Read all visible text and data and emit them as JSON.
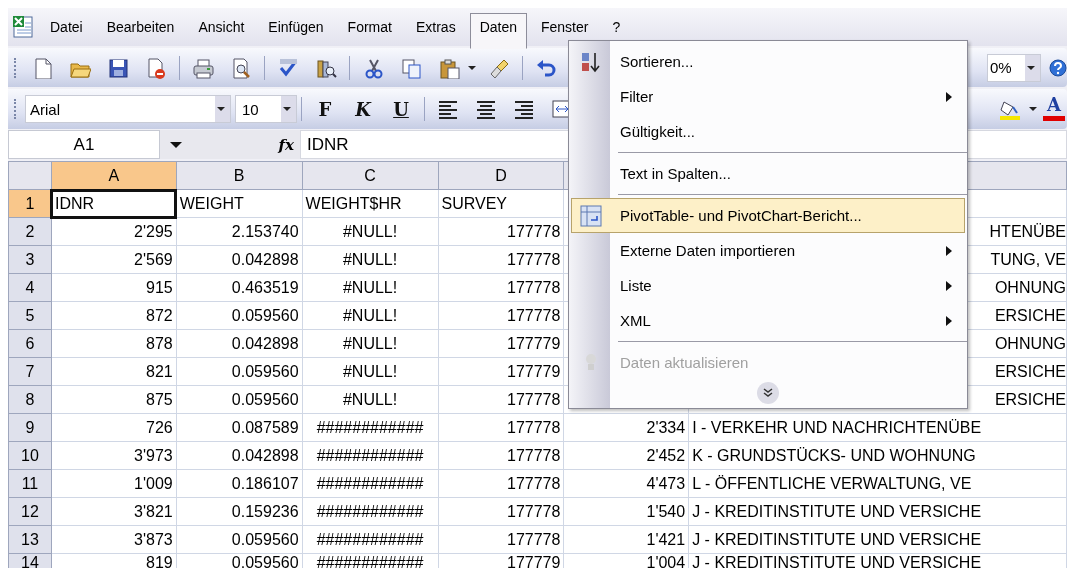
{
  "menu_bar": [
    {
      "label": "Datei",
      "selected": false
    },
    {
      "label": "Bearbeiten",
      "selected": false
    },
    {
      "label": "Ansicht",
      "selected": false
    },
    {
      "label": "Einfügen",
      "selected": false
    },
    {
      "label": "Format",
      "selected": false
    },
    {
      "label": "Extras",
      "selected": false
    },
    {
      "label": "Daten",
      "selected": true
    },
    {
      "label": "Fenster",
      "selected": false
    },
    {
      "label": "?",
      "selected": false
    }
  ],
  "standard_toolbar": {
    "zoom": "0%"
  },
  "formatting_toolbar": {
    "font": "Arial",
    "size": "10",
    "bold": "F",
    "italic": "K",
    "underline": "U",
    "font_color": "A"
  },
  "formula_bar": {
    "name_box": "A1",
    "function_label": "fx",
    "content": "IDNR"
  },
  "sheet": {
    "columns": [
      {
        "label": "A",
        "selected": true
      },
      {
        "label": "B",
        "selected": false
      },
      {
        "label": "C",
        "selected": false
      },
      {
        "label": "D",
        "selected": false
      }
    ],
    "rows": [
      {
        "number": "1",
        "selected": true,
        "cells": [
          "IDNR",
          "WEIGHT",
          "WEIGHT$HR",
          "SURVEY"
        ]
      },
      {
        "number": "2",
        "selected": false,
        "cells": [
          "2'295",
          "2.153740",
          "#NULL!",
          "177778"
        ],
        "column_f": {
          "text": "HTENÜBE",
          "covered": true
        }
      },
      {
        "number": "3",
        "selected": false,
        "cells": [
          "2'569",
          "0.042898",
          "#NULL!",
          "177778"
        ],
        "column_f": {
          "text": "TUNG, VE",
          "covered": true
        }
      },
      {
        "number": "4",
        "selected": false,
        "cells": [
          "915",
          "0.463519",
          "#NULL!",
          "177778"
        ],
        "column_f": {
          "text": "OHNUNG",
          "covered": true
        }
      },
      {
        "number": "5",
        "selected": false,
        "cells": [
          "872",
          "0.059560",
          "#NULL!",
          "177778"
        ],
        "column_f": {
          "text": "ERSICHE",
          "covered": true
        }
      },
      {
        "number": "6",
        "selected": false,
        "cells": [
          "878",
          "0.042898",
          "#NULL!",
          "177779"
        ],
        "column_f": {
          "text": "OHNUNG",
          "covered": true
        }
      },
      {
        "number": "7",
        "selected": false,
        "cells": [
          "821",
          "0.059560",
          "#NULL!",
          "177779"
        ],
        "column_f": {
          "text": "ERSICHE",
          "covered": true
        }
      },
      {
        "number": "8",
        "selected": false,
        "cells": [
          "875",
          "0.059560",
          "#NULL!",
          "177778"
        ],
        "column_f": {
          "text": "ERSICHE",
          "covered": true
        }
      },
      {
        "number": "9",
        "selected": false,
        "cells": [
          "726",
          "0.087589",
          "############",
          "177778"
        ],
        "column_e": "2'334",
        "column_f": {
          "text": "I - VERKEHR UND NACHRICHTENÜBE",
          "covered": false
        }
      },
      {
        "number": "10",
        "selected": false,
        "cells": [
          "3'973",
          "0.042898",
          "############",
          "177778"
        ],
        "column_e": "2'452",
        "column_f": {
          "text": "K - GRUNDSTÜCKS- UND WOHNUNG",
          "covered": false
        }
      },
      {
        "number": "11",
        "selected": false,
        "cells": [
          "1'009",
          "0.186107",
          "############",
          "177778"
        ],
        "column_e": "4'473",
        "column_f": {
          "text": "L - ÖFFENTLICHE VERWALTUNG, VE",
          "covered": false
        }
      },
      {
        "number": "12",
        "selected": false,
        "cells": [
          "3'821",
          "0.159236",
          "############",
          "177778"
        ],
        "column_e": "1'540",
        "column_f": {
          "text": "J - KREDITINSTITUTE UND VERSICHE",
          "covered": false
        }
      },
      {
        "number": "13",
        "selected": false,
        "cells": [
          "3'873",
          "0.059560",
          "############",
          "177778"
        ],
        "column_e": "1'421",
        "column_f": {
          "text": "J - KREDITINSTITUTE UND VERSICHE",
          "covered": false
        }
      },
      {
        "number": "14",
        "selected": false,
        "cells": [
          "819",
          "0.059560",
          "############",
          "177779"
        ],
        "column_e": "1'004",
        "column_f": {
          "text": "J - KREDITINSTITUTE UND VERSICHE",
          "covered": false
        }
      }
    ]
  },
  "data_menu": {
    "items": [
      {
        "kind": "command",
        "label": "Sortieren...",
        "selected": false,
        "disabled": false,
        "submenu": false
      },
      {
        "kind": "command",
        "label": "Filter",
        "selected": false,
        "disabled": false,
        "submenu": true
      },
      {
        "kind": "command",
        "label": "Gültigkeit...",
        "selected": false,
        "disabled": false,
        "submenu": false
      },
      {
        "kind": "separator"
      },
      {
        "kind": "command",
        "label": "Text in Spalten...",
        "selected": false,
        "disabled": false,
        "submenu": false
      },
      {
        "kind": "separator"
      },
      {
        "kind": "command",
        "label": "PivotTable- und PivotChart-Bericht...",
        "selected": true,
        "disabled": false,
        "submenu": false
      },
      {
        "kind": "command",
        "label": "Externe Daten importieren",
        "selected": false,
        "disabled": false,
        "submenu": true
      },
      {
        "kind": "command",
        "label": "Liste",
        "selected": false,
        "disabled": false,
        "submenu": true
      },
      {
        "kind": "command",
        "label": "XML",
        "selected": false,
        "disabled": false,
        "submenu": true
      },
      {
        "kind": "separator"
      },
      {
        "kind": "command",
        "label": "Daten aktualisieren",
        "selected": false,
        "disabled": true,
        "submenu": false
      },
      {
        "kind": "expand"
      }
    ]
  }
}
